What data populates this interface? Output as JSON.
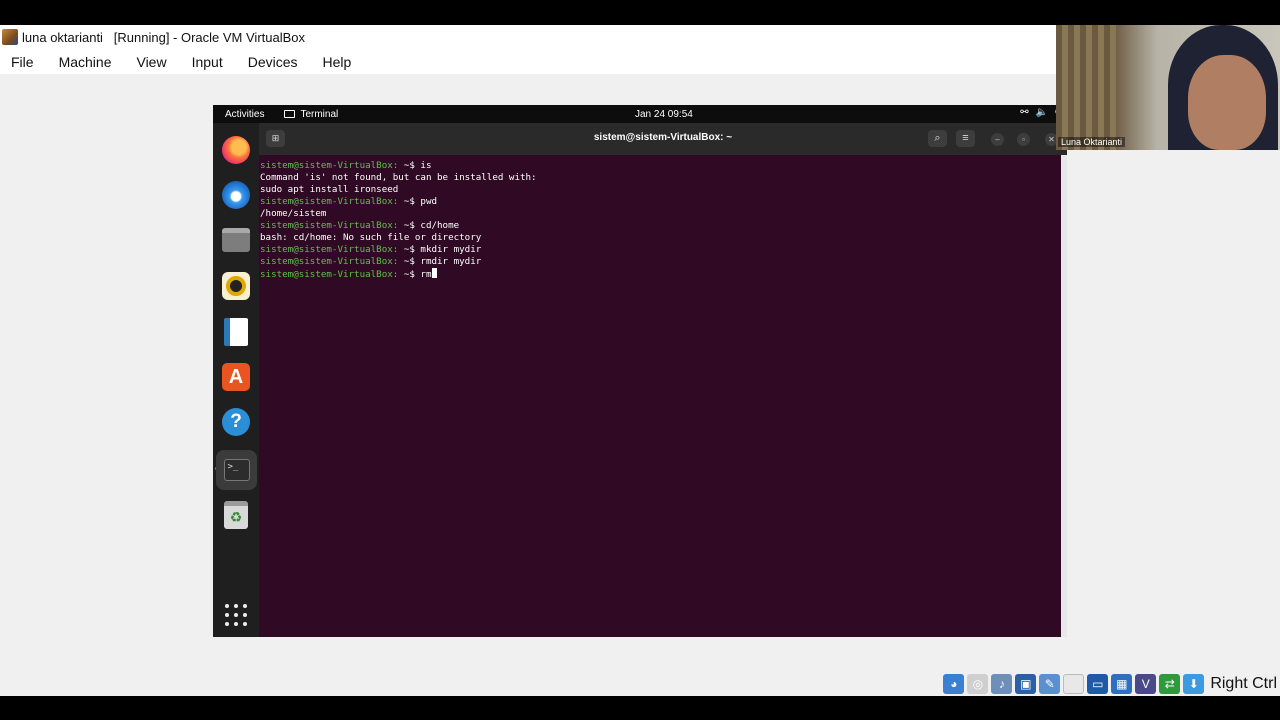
{
  "window": {
    "title": "luna oktarianti   [Running] - Oracle VM VirtualBox"
  },
  "menubar": {
    "items": [
      "File",
      "Machine",
      "View",
      "Input",
      "Devices",
      "Help"
    ]
  },
  "ubuntu": {
    "topbar": {
      "activities": "Activities",
      "app_name": "Terminal",
      "clock": "Jan 24  09:54",
      "tray_icons": [
        "network-icon",
        "volume-icon",
        "power-icon"
      ]
    },
    "dock": {
      "apps": [
        "firefox",
        "thunderbird",
        "files",
        "rhythmbox",
        "libreoffice-writer",
        "ubuntu-software",
        "help",
        "terminal",
        "trash"
      ],
      "active_app": "terminal",
      "show_apps_icon": "grid-icon"
    }
  },
  "terminal": {
    "title": "sistem@sistem-VirtualBox: ~",
    "prompt": "sistem@sistem-VirtualBox:",
    "prompt_color": "#5ec04b",
    "background": "#300a24",
    "lines": [
      {
        "prompt": true,
        "text": " ~$ is"
      },
      {
        "prompt": false,
        "text": "Command 'is' not found, but can be installed with:"
      },
      {
        "prompt": false,
        "text": "sudo apt install ironseed"
      },
      {
        "prompt": true,
        "text": " ~$ pwd"
      },
      {
        "prompt": false,
        "text": "/home/sistem"
      },
      {
        "prompt": true,
        "text": " ~$ cd/home"
      },
      {
        "prompt": false,
        "text": "bash: cd/home: No such file or directory"
      },
      {
        "prompt": true,
        "text": " ~$ mkdir mydir"
      },
      {
        "prompt": true,
        "text": " ~$ rmdir mydir"
      },
      {
        "prompt": true,
        "text": " ~$ rm"
      }
    ]
  },
  "webcam": {
    "participant_name": "Luna Oktarianti"
  },
  "statusbar": {
    "icons": [
      "hard-disk-icon",
      "optical-drive-icon",
      "audio-icon",
      "network-adapter-icon",
      "usb-icon",
      "shared-folder-icon",
      "display-icon",
      "recording-icon",
      "cpu-icon",
      "mouse-integration-icon",
      "keyboard-icon"
    ],
    "host_key": "Right Ctrl"
  }
}
